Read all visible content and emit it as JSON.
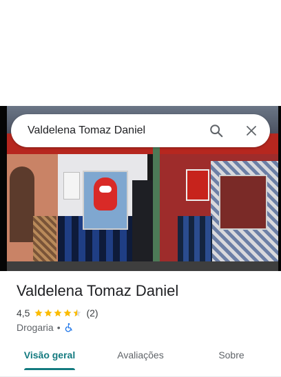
{
  "search": {
    "query": "Valdelena Tomaz Daniel",
    "search_icon": "search-icon",
    "close_icon": "close-icon"
  },
  "place": {
    "name": "Valdelena Tomaz Daniel",
    "rating": "4,5",
    "stars": 4.5,
    "review_count": "(2)",
    "category": "Drogaria",
    "separator": "•",
    "accessibility_icon": "wheelchair-icon"
  },
  "tabs": [
    {
      "label": "Visão geral",
      "active": true
    },
    {
      "label": "Avaliações",
      "active": false
    },
    {
      "label": "Sobre",
      "active": false
    }
  ],
  "colors": {
    "accent": "#137a7f",
    "star": "#fbbc04",
    "accessibility": "#1a73e8"
  }
}
